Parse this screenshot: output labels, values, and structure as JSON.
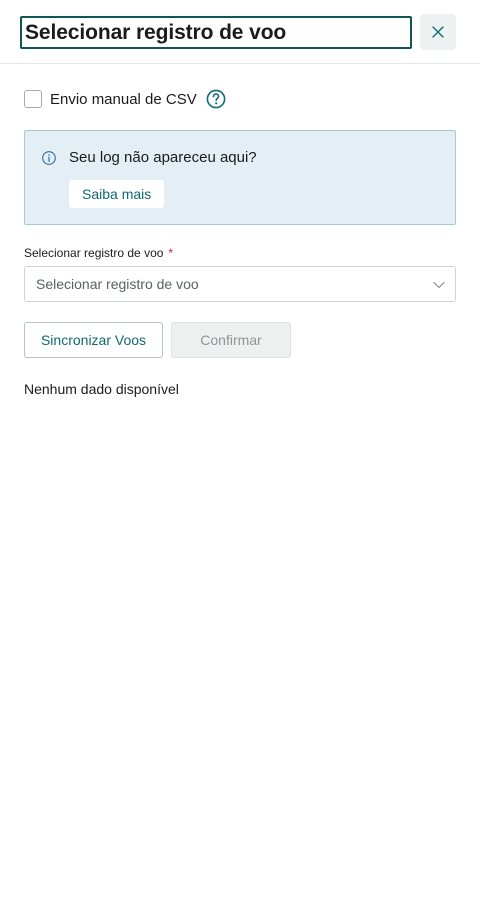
{
  "header": {
    "title": "Selecionar registro de voo",
    "close_icon": "close-icon"
  },
  "manual_csv": {
    "label": "Envio manual de CSV",
    "checked": false,
    "help_icon": "question-circle-icon"
  },
  "info_banner": {
    "icon": "info-circle-icon",
    "message": "Seu log não apareceu aqui?",
    "learn_more_label": "Saiba mais"
  },
  "flight_log_field": {
    "label": "Selecionar registro de voo",
    "required_marker": "*",
    "placeholder": "Selecionar registro de voo"
  },
  "actions": {
    "sync_label": "Sincronizar Voos",
    "confirm_label": "Confirmar",
    "confirm_disabled": true
  },
  "empty_state": "Nenhum dado disponível",
  "colors": {
    "accent": "#0f6b6f",
    "title_border": "#0f5457",
    "info_bg": "#e3eef5",
    "info_border": "#a9c7dc",
    "required": "#c62828"
  }
}
